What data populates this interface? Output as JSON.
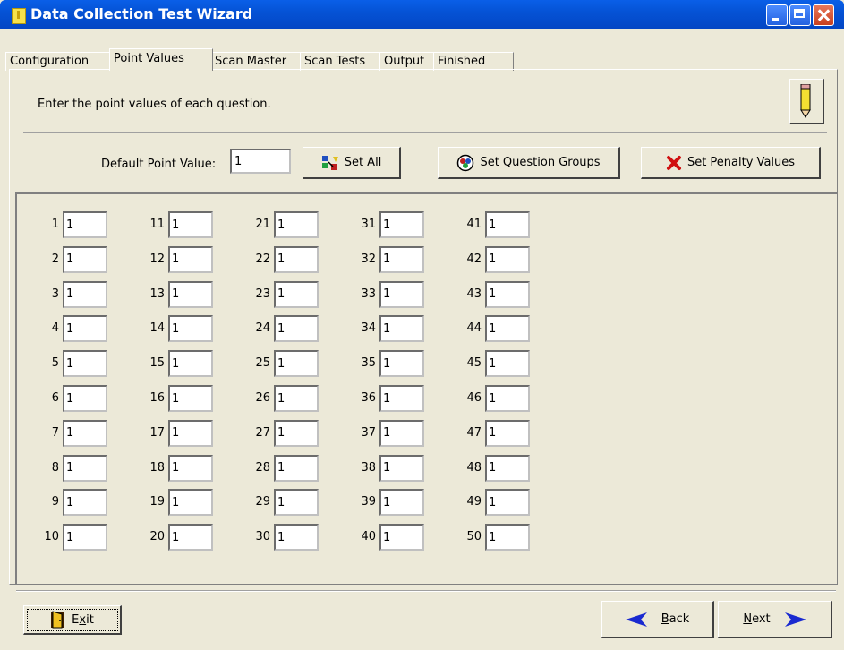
{
  "window": {
    "title": "Data Collection Test Wizard"
  },
  "tabs": [
    "Configuration",
    "Point Values",
    "Scan Master",
    "Scan Tests",
    "Output",
    "Finished"
  ],
  "active_tab": "Point Values",
  "instructions": "Enter the point values of each question.",
  "default_point": {
    "label": "Default Point Value:",
    "value": "1"
  },
  "buttons": {
    "set_all": {
      "pre": "Set ",
      "key": "A",
      "post": "ll"
    },
    "set_groups": {
      "pre": "Set Question ",
      "key": "G",
      "post": "roups"
    },
    "set_penalty": {
      "pre": "Set Penalty ",
      "key": "V",
      "post": "alues"
    },
    "exit": {
      "pre": "E",
      "key": "x",
      "post": "it"
    },
    "back": {
      "pre": "",
      "key": "B",
      "post": "ack"
    },
    "next": {
      "pre": "",
      "key": "N",
      "post": "ext"
    }
  },
  "questions": [
    {
      "n": "1",
      "v": "1"
    },
    {
      "n": "2",
      "v": "1"
    },
    {
      "n": "3",
      "v": "1"
    },
    {
      "n": "4",
      "v": "1"
    },
    {
      "n": "5",
      "v": "1"
    },
    {
      "n": "6",
      "v": "1"
    },
    {
      "n": "7",
      "v": "1"
    },
    {
      "n": "8",
      "v": "1"
    },
    {
      "n": "9",
      "v": "1"
    },
    {
      "n": "10",
      "v": "1"
    },
    {
      "n": "11",
      "v": "1"
    },
    {
      "n": "12",
      "v": "1"
    },
    {
      "n": "13",
      "v": "1"
    },
    {
      "n": "14",
      "v": "1"
    },
    {
      "n": "15",
      "v": "1"
    },
    {
      "n": "16",
      "v": "1"
    },
    {
      "n": "17",
      "v": "1"
    },
    {
      "n": "18",
      "v": "1"
    },
    {
      "n": "19",
      "v": "1"
    },
    {
      "n": "20",
      "v": "1"
    },
    {
      "n": "21",
      "v": "1"
    },
    {
      "n": "22",
      "v": "1"
    },
    {
      "n": "23",
      "v": "1"
    },
    {
      "n": "24",
      "v": "1"
    },
    {
      "n": "25",
      "v": "1"
    },
    {
      "n": "26",
      "v": "1"
    },
    {
      "n": "27",
      "v": "1"
    },
    {
      "n": "28",
      "v": "1"
    },
    {
      "n": "29",
      "v": "1"
    },
    {
      "n": "30",
      "v": "1"
    },
    {
      "n": "31",
      "v": "1"
    },
    {
      "n": "32",
      "v": "1"
    },
    {
      "n": "33",
      "v": "1"
    },
    {
      "n": "34",
      "v": "1"
    },
    {
      "n": "35",
      "v": "1"
    },
    {
      "n": "36",
      "v": "1"
    },
    {
      "n": "37",
      "v": "1"
    },
    {
      "n": "38",
      "v": "1"
    },
    {
      "n": "39",
      "v": "1"
    },
    {
      "n": "40",
      "v": "1"
    },
    {
      "n": "41",
      "v": "1"
    },
    {
      "n": "42",
      "v": "1"
    },
    {
      "n": "43",
      "v": "1"
    },
    {
      "n": "44",
      "v": "1"
    },
    {
      "n": "45",
      "v": "1"
    },
    {
      "n": "46",
      "v": "1"
    },
    {
      "n": "47",
      "v": "1"
    },
    {
      "n": "48",
      "v": "1"
    },
    {
      "n": "49",
      "v": "1"
    },
    {
      "n": "50",
      "v": "1"
    }
  ]
}
